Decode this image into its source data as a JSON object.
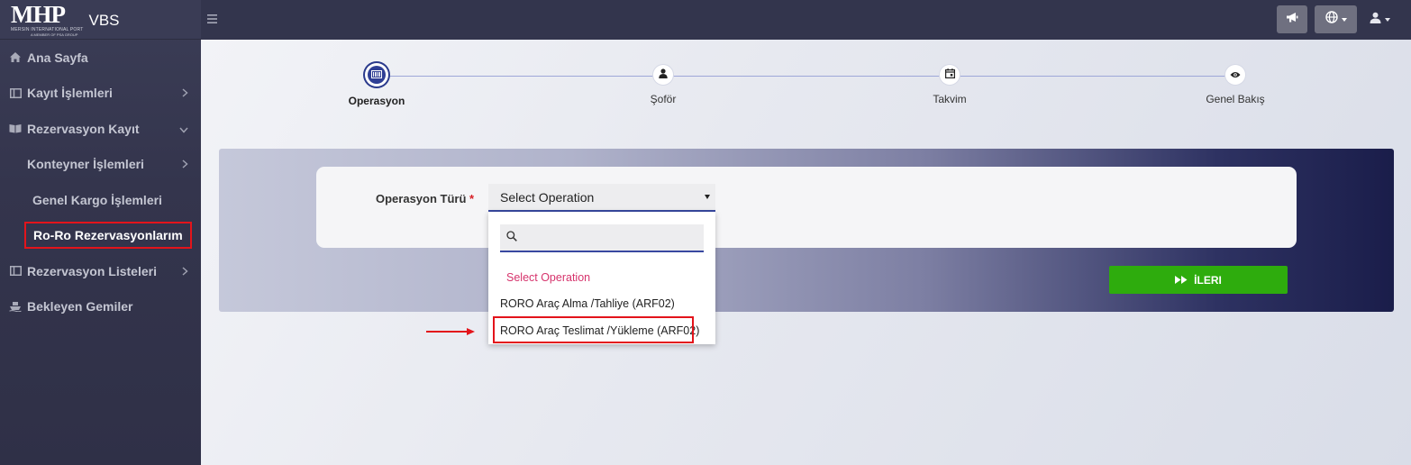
{
  "brand": {
    "logo_text": "MHP",
    "logo_sub": "MERSIN INTERNATIONAL PORT",
    "logo_sub2": "A MEMBER OF PSA GROUP",
    "app_name": "VBS"
  },
  "sidebar": {
    "items": [
      {
        "label": "Ana Sayfa",
        "icon": "home-icon"
      },
      {
        "label": "Kayıt İşlemleri",
        "icon": "panel-icon"
      },
      {
        "label": "Rezervasyon Kayıt",
        "icon": "book-icon"
      },
      {
        "label": "Konteyner İşlemleri"
      },
      {
        "label": "Genel Kargo İşlemleri"
      },
      {
        "label": "Ro-Ro Rezervasyonlarım"
      },
      {
        "label": "Rezervasyon Listeleri",
        "icon": "panel-icon"
      },
      {
        "label": "Bekleyen Gemiler",
        "icon": "ship-icon"
      }
    ]
  },
  "stepper": {
    "steps": [
      {
        "label": "Operasyon",
        "active": true
      },
      {
        "label": "Şoför"
      },
      {
        "label": "Takvim"
      },
      {
        "label": "Genel Bakış"
      }
    ]
  },
  "form": {
    "operation_label": "Operasyon Türü",
    "required_mark": "*",
    "select_value": "Select Operation",
    "next_button": "İLERI"
  },
  "dropdown": {
    "search_placeholder": "",
    "options": [
      "Select Operation",
      "RORO Araç Alma /Tahliye (ARF02)",
      "RORO Araç Teslimat /Yükleme (ARF02)"
    ]
  },
  "colors": {
    "accent": "#2f3f95",
    "success": "#2eac0d",
    "highlight": "#e3141b",
    "placeholder_option": "#d6336c"
  }
}
